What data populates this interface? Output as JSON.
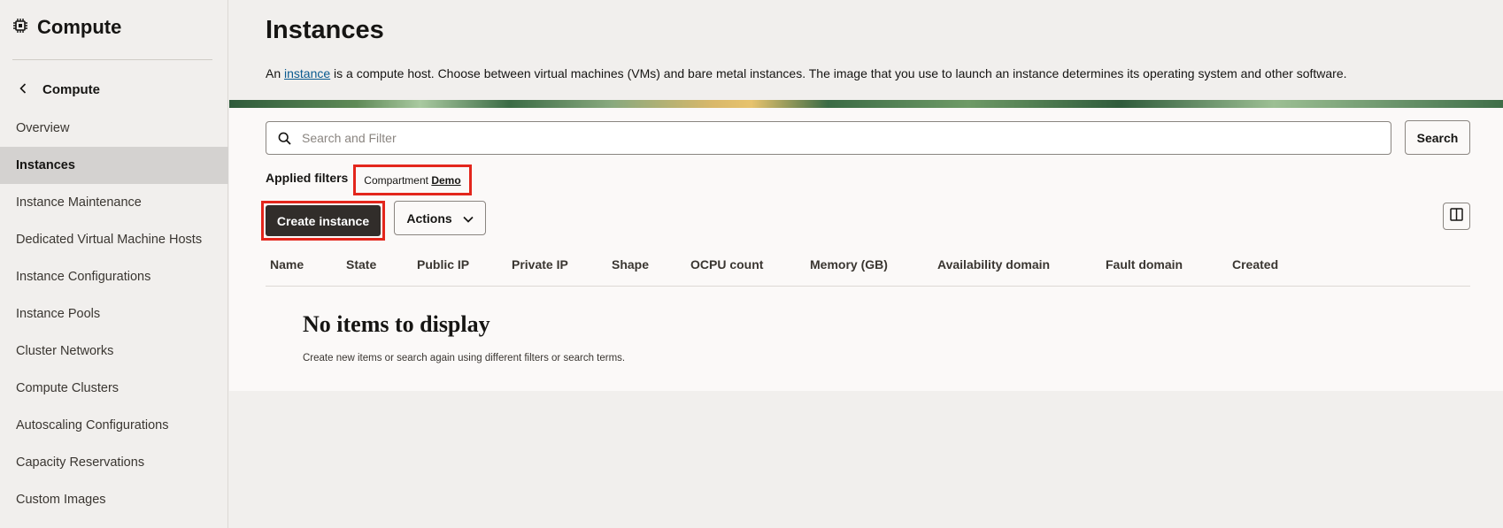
{
  "sidebar": {
    "app_icon": "chip-icon",
    "app_title": "Compute",
    "back_label": "Compute",
    "items": [
      {
        "label": "Overview",
        "active": false
      },
      {
        "label": "Instances",
        "active": true
      },
      {
        "label": "Instance Maintenance",
        "active": false
      },
      {
        "label": "Dedicated Virtual Machine Hosts",
        "active": false
      },
      {
        "label": "Instance Configurations",
        "active": false
      },
      {
        "label": "Instance Pools",
        "active": false
      },
      {
        "label": "Cluster Networks",
        "active": false
      },
      {
        "label": "Compute Clusters",
        "active": false
      },
      {
        "label": "Autoscaling Configurations",
        "active": false
      },
      {
        "label": "Capacity Reservations",
        "active": false
      },
      {
        "label": "Custom Images",
        "active": false
      }
    ]
  },
  "main": {
    "title": "Instances",
    "description": {
      "prefix": "An ",
      "link": "instance",
      "suffix": " is a compute host. Choose between virtual machines (VMs) and bare metal instances. The image that you use to launch an instance determines its operating system and other software."
    },
    "search": {
      "placeholder": "Search and Filter",
      "value": "",
      "button_label": "Search"
    },
    "filters": {
      "label": "Applied filters",
      "chips": [
        {
          "key": "Compartment",
          "value": "Demo"
        }
      ]
    },
    "toolbar": {
      "create_label": "Create instance",
      "actions_label": "Actions"
    },
    "table": {
      "columns": [
        "Name",
        "State",
        "Public IP",
        "Private IP",
        "Shape",
        "OCPU count",
        "Memory (GB)",
        "Availability domain",
        "Fault domain",
        "Created"
      ],
      "rows": []
    },
    "empty": {
      "title": "No items to display",
      "subtitle": "Create new items or search again using different filters or search terms."
    }
  },
  "colors": {
    "primary_button": "#312d2a",
    "highlight": "#e3261c",
    "link": "#0a5a8f",
    "active_nav": "#d4d2d0"
  }
}
